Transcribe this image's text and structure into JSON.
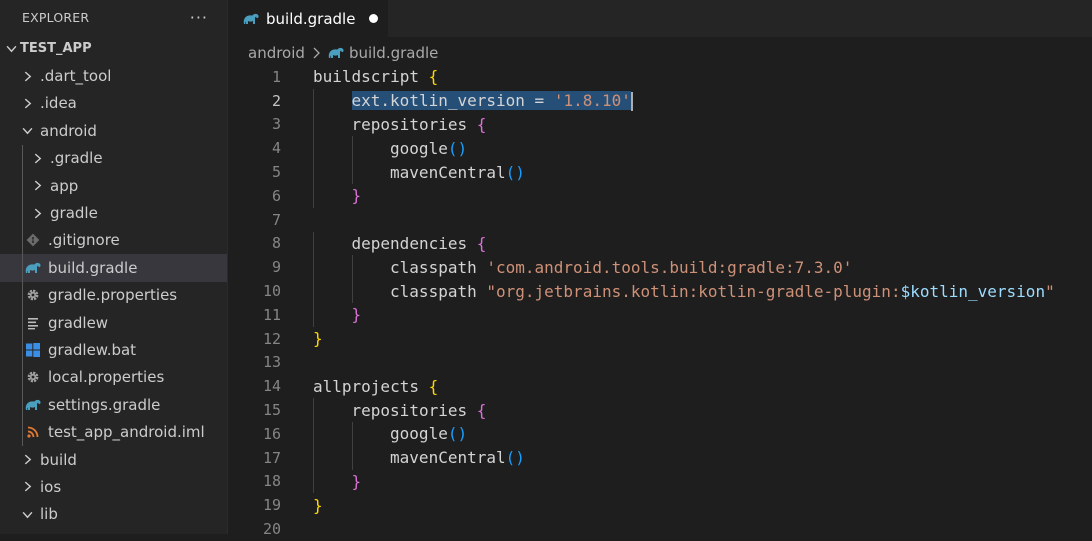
{
  "explorer": {
    "title": "EXPLORER",
    "more": "···",
    "tree": [
      {
        "label": "TEST_APP",
        "depth": 0,
        "kind": "root-open",
        "icon": "chevron-down"
      },
      {
        "label": ".dart_tool",
        "depth": 1,
        "kind": "folder-closed",
        "icon": "chevron-right"
      },
      {
        "label": ".idea",
        "depth": 1,
        "kind": "folder-closed",
        "icon": "chevron-right"
      },
      {
        "label": "android",
        "depth": 1,
        "kind": "folder-open",
        "icon": "chevron-down"
      },
      {
        "label": ".gradle",
        "depth": 2,
        "kind": "folder-closed",
        "icon": "chevron-right"
      },
      {
        "label": "app",
        "depth": 2,
        "kind": "folder-closed",
        "icon": "chevron-right"
      },
      {
        "label": "gradle",
        "depth": 2,
        "kind": "folder-closed",
        "icon": "chevron-right"
      },
      {
        "label": ".gitignore",
        "depth": 2,
        "kind": "file",
        "icon": "git-icon"
      },
      {
        "label": "build.gradle",
        "depth": 2,
        "kind": "file",
        "icon": "gradle-elephant-icon",
        "selected": true
      },
      {
        "label": "gradle.properties",
        "depth": 2,
        "kind": "file",
        "icon": "gear-icon"
      },
      {
        "label": "gradlew",
        "depth": 2,
        "kind": "file",
        "icon": "text-lines-icon"
      },
      {
        "label": "gradlew.bat",
        "depth": 2,
        "kind": "file",
        "icon": "windows-icon"
      },
      {
        "label": "local.properties",
        "depth": 2,
        "kind": "file",
        "icon": "gear-icon"
      },
      {
        "label": "settings.gradle",
        "depth": 2,
        "kind": "file",
        "icon": "gradle-elephant-icon"
      },
      {
        "label": "test_app_android.iml",
        "depth": 2,
        "kind": "file",
        "icon": "rss-icon"
      },
      {
        "label": "build",
        "depth": 1,
        "kind": "folder-closed",
        "icon": "chevron-right"
      },
      {
        "label": "ios",
        "depth": 1,
        "kind": "folder-closed",
        "icon": "chevron-right"
      },
      {
        "label": "lib",
        "depth": 1,
        "kind": "folder-open",
        "icon": "chevron-down"
      }
    ]
  },
  "tab": {
    "label": "build.gradle",
    "modified_indicator": "unsaved-dot"
  },
  "breadcrumb": {
    "folder": "android",
    "file": "build.gradle"
  },
  "editor": {
    "active_line": 2,
    "lines": [
      {
        "n": "1",
        "indent": 0,
        "tokens": [
          {
            "t": "buildscript ",
            "c": "t-default"
          },
          {
            "t": "{",
            "c": "b1"
          }
        ]
      },
      {
        "n": "2",
        "indent": 1,
        "selected": true,
        "tokens": [
          {
            "t": "ext.kotlin_version = '1.8.10'",
            "c": "t-default-mixed"
          }
        ]
      },
      {
        "n": "3",
        "indent": 1,
        "tokens": [
          {
            "t": "repositories ",
            "c": "t-default"
          },
          {
            "t": "{",
            "c": "b2"
          }
        ]
      },
      {
        "n": "4",
        "indent": 2,
        "tokens": [
          {
            "t": "google",
            "c": "t-default"
          },
          {
            "t": "()",
            "c": "b3"
          }
        ]
      },
      {
        "n": "5",
        "indent": 2,
        "tokens": [
          {
            "t": "mavenCentral",
            "c": "t-default"
          },
          {
            "t": "()",
            "c": "b3"
          }
        ]
      },
      {
        "n": "6",
        "indent": 1,
        "tokens": [
          {
            "t": "}",
            "c": "b2"
          }
        ]
      },
      {
        "n": "7",
        "indent": 0,
        "tokens": []
      },
      {
        "n": "8",
        "indent": 1,
        "tokens": [
          {
            "t": "dependencies ",
            "c": "t-default"
          },
          {
            "t": "{",
            "c": "b2"
          }
        ]
      },
      {
        "n": "9",
        "indent": 2,
        "tokens": [
          {
            "t": "classpath ",
            "c": "t-default"
          },
          {
            "t": "'com.android.tools.build:gradle:7.3.0'",
            "c": "t-str"
          }
        ]
      },
      {
        "n": "10",
        "indent": 2,
        "tokens": [
          {
            "t": "classpath ",
            "c": "t-default"
          },
          {
            "t": "\"org.jetbrains.kotlin:kotlin-gradle-plugin:",
            "c": "t-str"
          },
          {
            "t": "$kotlin_version",
            "c": "t-var"
          },
          {
            "t": "\"",
            "c": "t-str"
          }
        ]
      },
      {
        "n": "11",
        "indent": 1,
        "tokens": [
          {
            "t": "}",
            "c": "b2"
          }
        ]
      },
      {
        "n": "12",
        "indent": 0,
        "tokens": [
          {
            "t": "}",
            "c": "b1"
          }
        ]
      },
      {
        "n": "13",
        "indent": 0,
        "tokens": []
      },
      {
        "n": "14",
        "indent": 0,
        "tokens": [
          {
            "t": "allprojects ",
            "c": "t-default"
          },
          {
            "t": "{",
            "c": "b1"
          }
        ]
      },
      {
        "n": "15",
        "indent": 1,
        "tokens": [
          {
            "t": "repositories ",
            "c": "t-default"
          },
          {
            "t": "{",
            "c": "b2"
          }
        ]
      },
      {
        "n": "16",
        "indent": 2,
        "tokens": [
          {
            "t": "google",
            "c": "t-default"
          },
          {
            "t": "()",
            "c": "b3"
          }
        ]
      },
      {
        "n": "17",
        "indent": 2,
        "tokens": [
          {
            "t": "mavenCentral",
            "c": "t-default"
          },
          {
            "t": "()",
            "c": "b3"
          }
        ]
      },
      {
        "n": "18",
        "indent": 1,
        "tokens": [
          {
            "t": "}",
            "c": "b2"
          }
        ]
      },
      {
        "n": "19",
        "indent": 0,
        "tokens": [
          {
            "t": "}",
            "c": "b1"
          }
        ]
      },
      {
        "n": "20",
        "indent": 0,
        "tokens": []
      }
    ]
  },
  "colors": {
    "editor_bg": "#1e1e1e",
    "sidebar_bg": "#252526",
    "selection": "#264f78",
    "gradle_icon": "#4a9fbf",
    "gear_icon": "#a0a0a0",
    "windows_icon": "#3a8ee6",
    "rss_icon": "#e37933",
    "git_icon": "#6b6b6b"
  }
}
